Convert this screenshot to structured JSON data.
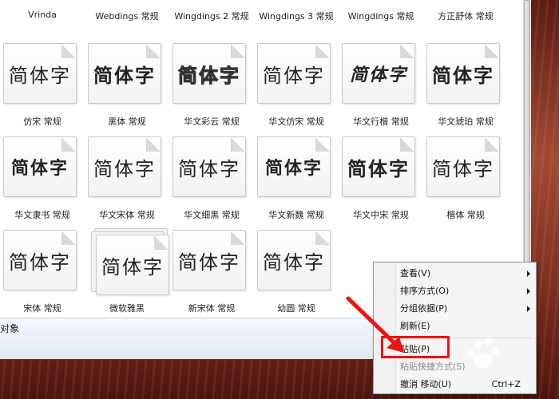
{
  "top_row_labels": [
    "Vrinda",
    "Webdings 常规",
    "Wingdings 2 常规",
    "Wingdings 3 常规",
    "Wingdings 常规",
    "方正舒体 常规"
  ],
  "sample_text": "简体字",
  "fonts": [
    {
      "label": "仿宋 常规"
    },
    {
      "label": "黑体 常规"
    },
    {
      "label": "华文彩云 常规"
    },
    {
      "label": "华文仿宋 常规"
    },
    {
      "label": "华文行楷 常规"
    },
    {
      "label": "华文琥珀 常规"
    },
    {
      "label": "华文隶书 常规"
    },
    {
      "label": "华文宋体 常规"
    },
    {
      "label": "华文细黑 常规"
    },
    {
      "label": "华文新魏 常规"
    },
    {
      "label": "华文中宋 常规"
    },
    {
      "label": "楷体 常规"
    },
    {
      "label": "宋体 常规"
    },
    {
      "label": "微软雅黑"
    },
    {
      "label": "新宋体 常规"
    },
    {
      "label": "幼圆 常规"
    }
  ],
  "status_bar": {
    "text": "对象"
  },
  "context_menu": {
    "items": [
      {
        "label": "查看(V)",
        "submenu": true
      },
      {
        "label": "排序方式(O)",
        "submenu": true
      },
      {
        "label": "分组依据(P)",
        "submenu": true
      },
      {
        "label": "刷新(E)"
      },
      {
        "label": "粘贴(P)"
      },
      {
        "label": "粘贴快捷方式(S)",
        "disabled": true
      },
      {
        "label": "撤消 移动(U)",
        "shortcut": "Ctrl+Z"
      }
    ]
  },
  "colors": {
    "annotation": "#f01010",
    "desktop": "#8b3b2a"
  }
}
